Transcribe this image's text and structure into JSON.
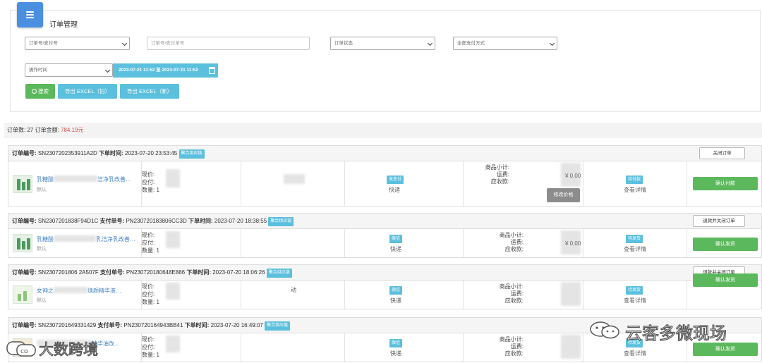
{
  "header": {
    "title": "订单管理"
  },
  "filters": {
    "order_no_select": "订单号/支付号",
    "order_no_placeholder": "订单号/支付单号",
    "status_select": "订单状态",
    "payment_select": "全部支付方式",
    "time_select": "操作时间",
    "date_range": "2023-07-21 11:52 至 2023-07-21 11:52"
  },
  "buttons": {
    "search": "搜索",
    "export_old": "导出 EXCEL（旧）",
    "export_new": "导出 EXCEL（新）"
  },
  "summary": {
    "count_label": "订单数: ",
    "count": "27",
    "amount_label": " 订单金额: ",
    "amount": "784.19元"
  },
  "labels": {
    "order_no": "订单编号:",
    "pay_no": "支付单号:",
    "order_time": "下单时间:",
    "supply_tag": "聚合供应链",
    "current_price": "现价:",
    "payable": "应付:",
    "quantity": "数量:",
    "subtotal": "商品小计:",
    "shipping_fee": "运费:",
    "receivable": "应收款:",
    "shipping_method": "快递",
    "view_detail": "查看详情",
    "default_variant": "默认",
    "modify_price": "修改价格"
  },
  "orders": [
    {
      "order_no": "SN2307202353911A2D",
      "pay_no": "",
      "time": "2023-07-20 23:53:45",
      "close_label": "关闭订单",
      "product_name": "乳糖酸",
      "product_suffix": "洁净乳改善…",
      "qty": "1",
      "extra": "",
      "pay_status": "未支付",
      "order_status": "待付款",
      "shipping_value": "¥ 0.00",
      "action": "确认付款"
    },
    {
      "order_no": "SN2307201838F94D1C",
      "pay_no": "PN230720183806CC3D",
      "time": "2023-07-20 18:38:55",
      "close_label": "退款并关闭订单",
      "product_name": "乳糖酸",
      "product_suffix": "乳洁净乳改善…",
      "qty": "1",
      "extra": "",
      "pay_status": "微信",
      "order_status": "待发货",
      "shipping_value": "¥ 0.00",
      "action": "确认发货"
    },
    {
      "order_no": "SN2307201806 2A507F",
      "pay_no": "PN230720180648E886",
      "time": "2023-07-20 18:06:26",
      "close_label": "退款并关闭订单",
      "product_name": "女神之",
      "product_suffix": "焕颜精华液…",
      "qty": "1",
      "extra": "动",
      "pay_status": "微信",
      "order_status": "待发货",
      "shipping_value": "",
      "action": "确认发货"
    },
    {
      "order_no": "SN2307201649331429",
      "pay_no": "PN230720164943BB41",
      "time": "2023-07-20 16:49:07",
      "close_label": "",
      "product_name": "",
      "product_suffix": "精华油改…",
      "qty": "1",
      "extra": "",
      "pay_status": "微信",
      "order_status": "待发货",
      "shipping_value": "",
      "action": "确认发货"
    }
  ],
  "watermarks": {
    "right": "云客多微现场",
    "left": "大数跨境"
  },
  "colors": {
    "primary": "#5bc0de",
    "success": "#5cb85c",
    "danger": "#d9534f",
    "menu": "#4a8fe0"
  }
}
